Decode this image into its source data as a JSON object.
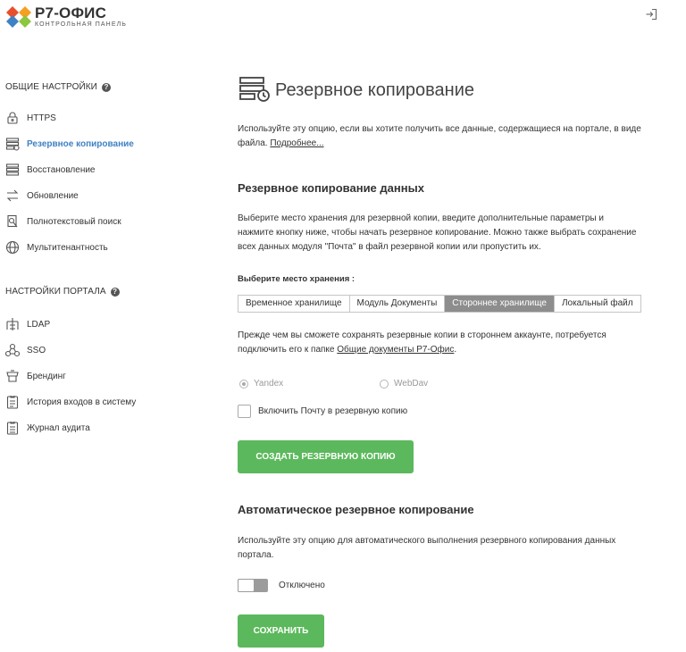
{
  "header": {
    "logo_title": "Р7-ОФИС",
    "logo_subtitle": "КОНТРОЛЬНАЯ ПАНЕЛЬ",
    "logo_colors": [
      "#e8502c",
      "#f4a020",
      "#3f82c4",
      "#8dc63f"
    ],
    "logout_icon": "sign-out-icon"
  },
  "sidebar": {
    "general_title": "ОБЩИЕ НАСТРОЙКИ",
    "general_items": [
      {
        "label": "HTTPS",
        "icon": "lock-icon"
      },
      {
        "label": "Резервное копирование",
        "icon": "backup-icon",
        "active": true
      },
      {
        "label": "Восстановление",
        "icon": "restore-icon"
      },
      {
        "label": "Обновление",
        "icon": "update-icon"
      },
      {
        "label": "Полнотекстовый поиск",
        "icon": "search-icon"
      },
      {
        "label": "Мультитенантность",
        "icon": "globe-icon"
      }
    ],
    "portal_title": "НАСТРОЙКИ ПОРТАЛА",
    "portal_items": [
      {
        "label": "LDAP",
        "icon": "ldap-icon"
      },
      {
        "label": "SSO",
        "icon": "sso-icon"
      },
      {
        "label": "Брендинг",
        "icon": "branding-icon"
      },
      {
        "label": "История входов в систему",
        "icon": "login-history-icon"
      },
      {
        "label": "Журнал аудита",
        "icon": "audit-log-icon"
      }
    ],
    "help_glyph": "?"
  },
  "main": {
    "title": "Резервное копирование",
    "intro": "Используйте эту опцию, если вы хотите получить все данные, содержащиеся на портале, в виде файла.",
    "intro_link": "Подробнее...",
    "backup_section": {
      "title": "Резервное копирование данных",
      "description": "Выберите место хранения для резервной копии, введите дополнительные параметры и нажмите кнопку ниже, чтобы начать резервное копирование. Можно также выбрать сохранение всех данных модуля \"Почта\" в файл резервной копии или пропустить их.",
      "storage_label": "Выберите место хранения :",
      "storage_tabs": [
        "Временное хранилище",
        "Модуль Документы",
        "Стороннее хранилище",
        "Локальный файл"
      ],
      "storage_selected": "Стороннее хранилище",
      "third_party_note": "Прежде чем вы сможете сохранять резервные копии в стороннем аккаунте, потребуется подключить его к папке",
      "third_party_link": "Общие документы Р7-Офис",
      "third_party_end": ".",
      "providers": [
        "Yandex",
        "WebDav"
      ],
      "provider_selected": "Yandex",
      "include_mail_label": "Включить Почту в резервную копию",
      "include_mail_checked": false,
      "create_button": "СОЗДАТЬ РЕЗЕРВНУЮ КОПИЮ"
    },
    "auto_section": {
      "title": "Автоматическое резервное копирование",
      "description": "Используйте эту опцию для автоматического выполнения резервного копирования данных портала.",
      "toggle_state": "Отключено",
      "toggle_on": false,
      "save_button": "СОХРАНИТЬ"
    }
  },
  "colors": {
    "accent_blue": "#3f82c4",
    "button_green": "#5cb85c",
    "tab_active_gray": "#8d8d8d"
  }
}
